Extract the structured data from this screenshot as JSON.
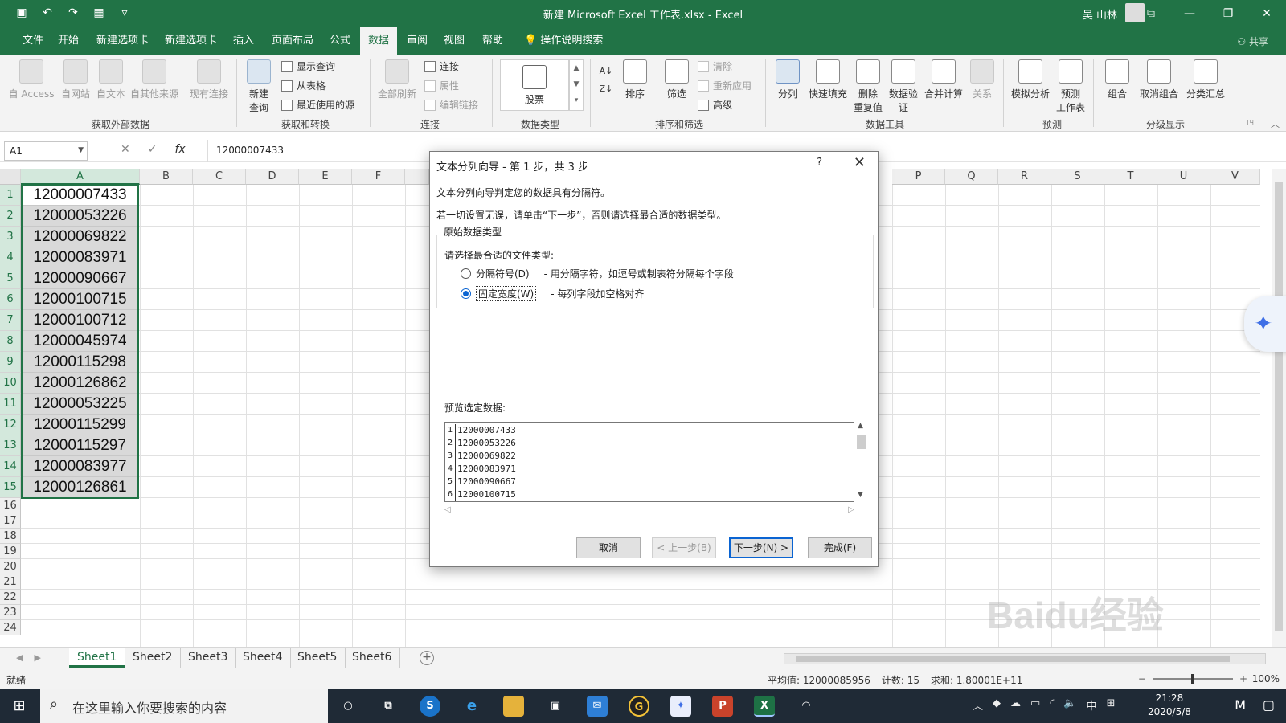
{
  "window": {
    "title": "新建 Microsoft Excel 工作表.xlsx  -  Excel",
    "user": "吴 山林"
  },
  "tabs": [
    "文件",
    "开始",
    "新建选项卡",
    "新建选项卡",
    "插入",
    "页面布局",
    "公式",
    "数据",
    "审阅",
    "视图",
    "帮助"
  ],
  "active_tab": "数据",
  "tell_me": "操作说明搜索",
  "share": "共享",
  "ribbon": {
    "groups": {
      "get_external": "获取外部数据",
      "get_transform": "获取和转换",
      "connections": "连接",
      "data_types": "数据类型",
      "sort_filter": "排序和筛选",
      "data_tools": "数据工具",
      "forecast": "预测",
      "outline": "分级显示"
    },
    "buttons": {
      "from_access": "自 Access",
      "from_web": "自网站",
      "from_text": "自文本",
      "from_other": "自其他来源",
      "existing": "现有连接",
      "new_query": "新建\n查询",
      "show_queries": "显示查询",
      "from_table": "从表格",
      "recent_sources": "最近使用的源",
      "refresh_all": "全部刷新",
      "connections": "连接",
      "properties": "属性",
      "edit_links": "编辑链接",
      "stocks": "股票",
      "sort": "排序",
      "filter": "筛选",
      "clear": "清除",
      "reapply": "重新应用",
      "advanced": "高级",
      "text_to_columns": "分列",
      "flash_fill": "快速填充",
      "remove_dup": "删除\n重复值",
      "validation": "数据验\n证",
      "consolidate": "合并计算",
      "relationships": "关系",
      "whatif": "模拟分析",
      "forecast_sheet": "预测\n工作表",
      "group": "组合",
      "ungroup": "取消组合",
      "subtotal": "分类汇总"
    }
  },
  "formula_bar": {
    "name_box": "A1",
    "value": "12000007433"
  },
  "columns": [
    "A",
    "B",
    "C",
    "D",
    "E",
    "F",
    "P",
    "Q",
    "R",
    "S",
    "T",
    "U",
    "V"
  ],
  "rows": [
    "1",
    "2",
    "3",
    "4",
    "5",
    "6",
    "7",
    "8",
    "9",
    "10",
    "11",
    "12",
    "13",
    "14",
    "15",
    "16",
    "17",
    "18",
    "19",
    "20",
    "21",
    "22",
    "23",
    "24"
  ],
  "column_a": [
    "12000007433",
    "12000053226",
    "12000069822",
    "12000083971",
    "12000090667",
    "12000100715",
    "12000100712",
    "12000045974",
    "12000115298",
    "12000126862",
    "12000053225",
    "12000115299",
    "12000115297",
    "12000083977",
    "12000126861"
  ],
  "sheets": [
    "Sheet1",
    "Sheet2",
    "Sheet3",
    "Sheet4",
    "Sheet5",
    "Sheet6"
  ],
  "status": {
    "ready": "就绪",
    "average": "平均值: 12000085956",
    "count": "计数: 15",
    "sum": "求和: 1.80001E+11",
    "zoom": "100%"
  },
  "dialog": {
    "title": "文本分列向导 - 第 1 步，共 3 步",
    "help": "?",
    "line1": "文本分列向导判定您的数据具有分隔符。",
    "line2": "若一切设置无误，请单击“下一步”，否则请选择最合适的数据类型。",
    "group_label": "原始数据类型",
    "choose_label": "请选择最合适的文件类型:",
    "opt_delimited": "分隔符号(D)",
    "opt_delimited_desc": "- 用分隔字符，如逗号或制表符分隔每个字段",
    "opt_fixed": "固定宽度(W)",
    "opt_fixed_desc": "- 每列字段加空格对齐",
    "selected_option": "fixed",
    "preview_label": "预览选定数据:",
    "preview_rows": [
      {
        "n": "1",
        "v": "12000007433"
      },
      {
        "n": "2",
        "v": "12000053226"
      },
      {
        "n": "3",
        "v": "12000069822"
      },
      {
        "n": "4",
        "v": "12000083971"
      },
      {
        "n": "5",
        "v": "12000090667"
      },
      {
        "n": "6",
        "v": "12000100715"
      }
    ],
    "btn_cancel": "取消",
    "btn_back": "< 上一步(B)",
    "btn_next": "下一步(N) >",
    "btn_finish": "完成(F)"
  },
  "taskbar": {
    "search_placeholder": "在这里输入你要搜索的内容",
    "time": "21:28",
    "date": "2020/5/8",
    "ime": "中"
  },
  "watermark": "Baidu经验",
  "colors": {
    "excel_green": "#217346",
    "taskbar": "#1f2a36",
    "accent_blue": "#0a64d2"
  }
}
